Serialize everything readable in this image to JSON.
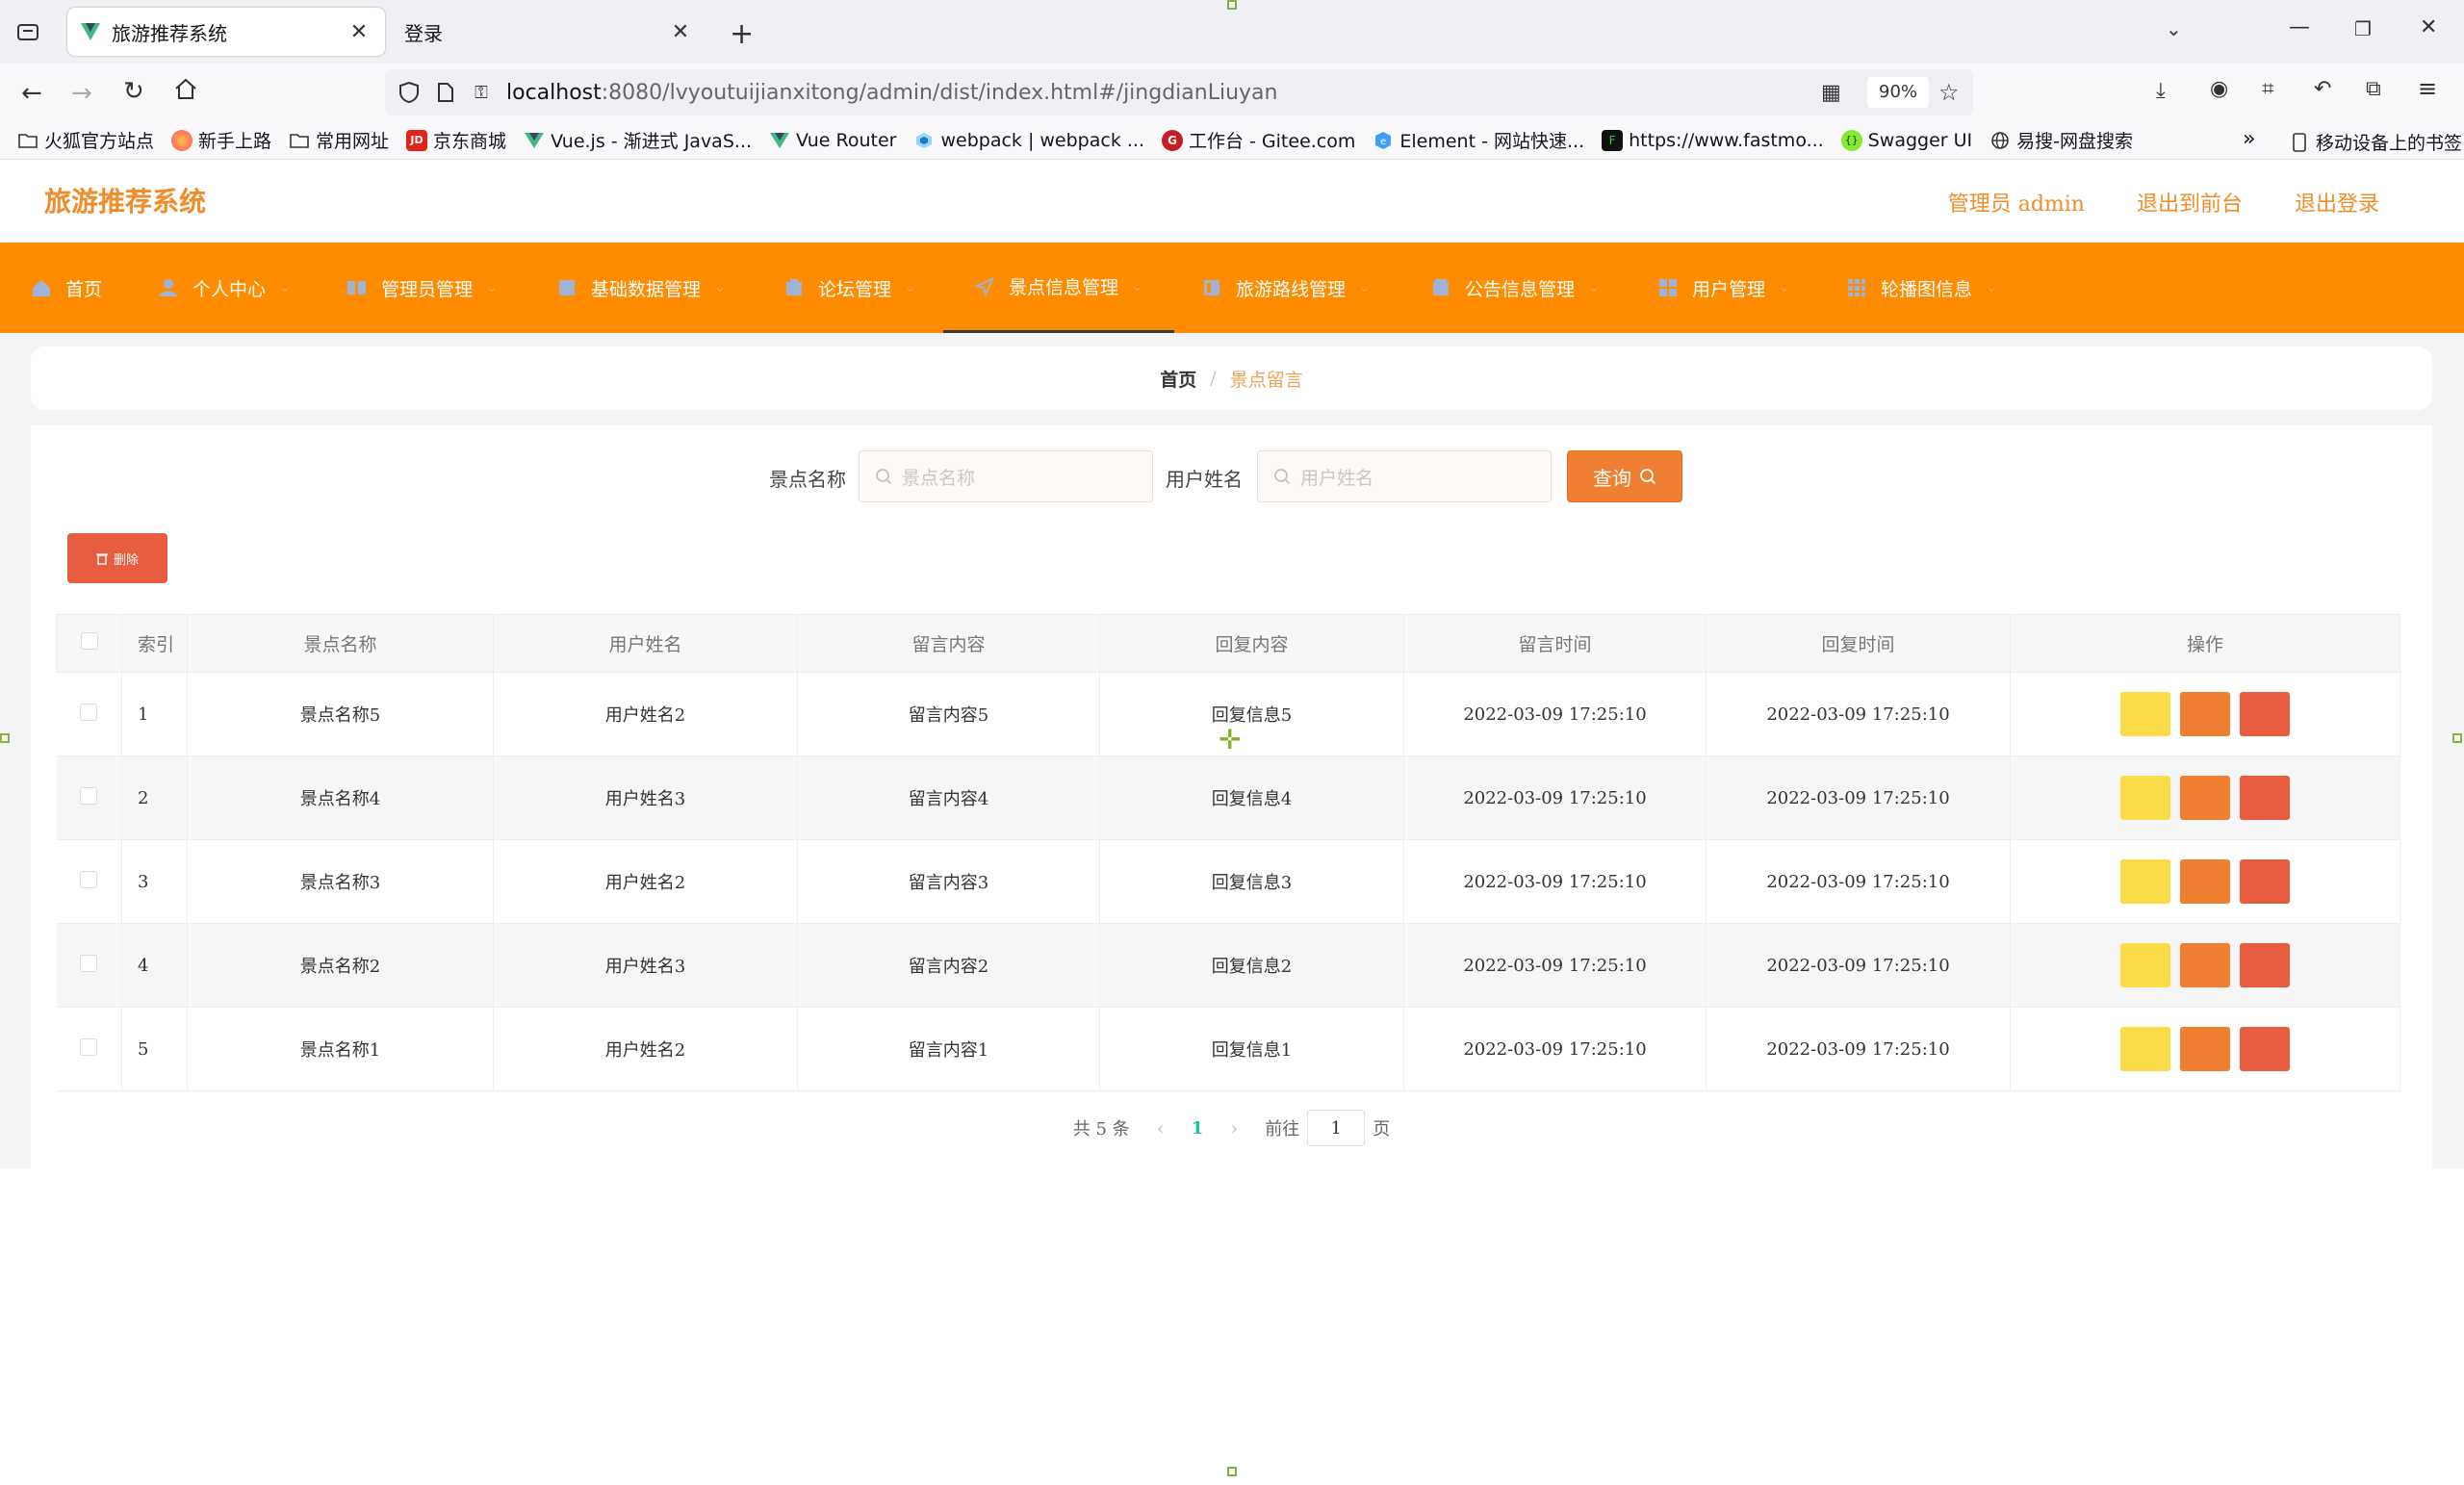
{
  "browser": {
    "tabs": [
      {
        "title": "旅游推荐系统",
        "active": true
      },
      {
        "title": "登录",
        "active": false
      }
    ],
    "url_host": "localhost",
    "url_rest": ":8080/lvyoutuijianxitong/admin/dist/index.html#/jingdianLiuyan",
    "zoom": "90%",
    "bookmarks": [
      {
        "label": "火狐官方站点",
        "icon": "folder-icon"
      },
      {
        "label": "新手上路",
        "icon": "firefox-icon"
      },
      {
        "label": "常用网址",
        "icon": "folder-icon"
      },
      {
        "label": "京东商城",
        "icon": "jd-icon"
      },
      {
        "label": "Vue.js - 渐进式 JavaS...",
        "icon": "vue-icon"
      },
      {
        "label": "Vue Router",
        "icon": "vue-icon"
      },
      {
        "label": "webpack | webpack ...",
        "icon": "webpack-icon"
      },
      {
        "label": "工作台 - Gitee.com",
        "icon": "gitee-icon"
      },
      {
        "label": "Element - 网站快速...",
        "icon": "element-icon"
      },
      {
        "label": "https://www.fastmo...",
        "icon": "fastmock-icon"
      },
      {
        "label": "Swagger UI",
        "icon": "swagger-icon"
      },
      {
        "label": "易搜-网盘搜索",
        "icon": "globe-icon"
      }
    ],
    "mobile_bookmarks": "移动设备上的书签"
  },
  "app": {
    "title": "旅游推荐系统",
    "header_links": {
      "admin": "管理员 admin",
      "frontend": "退出到前台",
      "logout": "退出登录"
    },
    "menu": [
      {
        "label": "首页",
        "icon": "home-icon",
        "has_arrow": false
      },
      {
        "label": "个人中心",
        "icon": "user-icon",
        "has_arrow": true
      },
      {
        "label": "管理员管理",
        "icon": "admin-icon",
        "has_arrow": true
      },
      {
        "label": "基础数据管理",
        "icon": "data-icon",
        "has_arrow": true
      },
      {
        "label": "论坛管理",
        "icon": "forum-icon",
        "has_arrow": true
      },
      {
        "label": "景点信息管理",
        "icon": "location-icon",
        "has_arrow": true,
        "active": true
      },
      {
        "label": "旅游路线管理",
        "icon": "route-icon",
        "has_arrow": true
      },
      {
        "label": "公告信息管理",
        "icon": "notice-icon",
        "has_arrow": true
      },
      {
        "label": "用户管理",
        "icon": "grid-icon",
        "has_arrow": true
      },
      {
        "label": "轮播图信息",
        "icon": "carousel-icon",
        "has_arrow": true
      }
    ],
    "breadcrumb": {
      "home": "首页",
      "current": "景点留言"
    },
    "search": {
      "scenic_label": "景点名称",
      "scenic_placeholder": "景点名称",
      "user_label": "用户姓名",
      "user_placeholder": "用户姓名",
      "query_button": "查询"
    },
    "delete_button": "删除",
    "table": {
      "headers": [
        "索引",
        "景点名称",
        "用户姓名",
        "留言内容",
        "回复内容",
        "留言时间",
        "回复时间",
        "操作"
      ],
      "rows": [
        [
          "1",
          "景点名称5",
          "用户姓名2",
          "留言内容5",
          "回复信息5",
          "2022-03-09 17:25:10",
          "2022-03-09 17:25:10"
        ],
        [
          "2",
          "景点名称4",
          "用户姓名3",
          "留言内容4",
          "回复信息4",
          "2022-03-09 17:25:10",
          "2022-03-09 17:25:10"
        ],
        [
          "3",
          "景点名称3",
          "用户姓名2",
          "留言内容3",
          "回复信息3",
          "2022-03-09 17:25:10",
          "2022-03-09 17:25:10"
        ],
        [
          "4",
          "景点名称2",
          "用户姓名3",
          "留言内容2",
          "回复信息2",
          "2022-03-09 17:25:10",
          "2022-03-09 17:25:10"
        ],
        [
          "5",
          "景点名称1",
          "用户姓名2",
          "留言内容1",
          "回复信息1",
          "2022-03-09 17:25:10",
          "2022-03-09 17:25:10"
        ]
      ],
      "action_colors": [
        "#f9dc48",
        "#f07f32",
        "#e85c40"
      ]
    },
    "pagination": {
      "total": "共 5 条",
      "current_page": "1",
      "goto_label": "前往",
      "goto_value": "1",
      "page_unit": "页"
    },
    "colors": {
      "accent": "#ff8c00",
      "brand_text": "#f08d2a",
      "page_link": "#1dbfa0"
    }
  }
}
